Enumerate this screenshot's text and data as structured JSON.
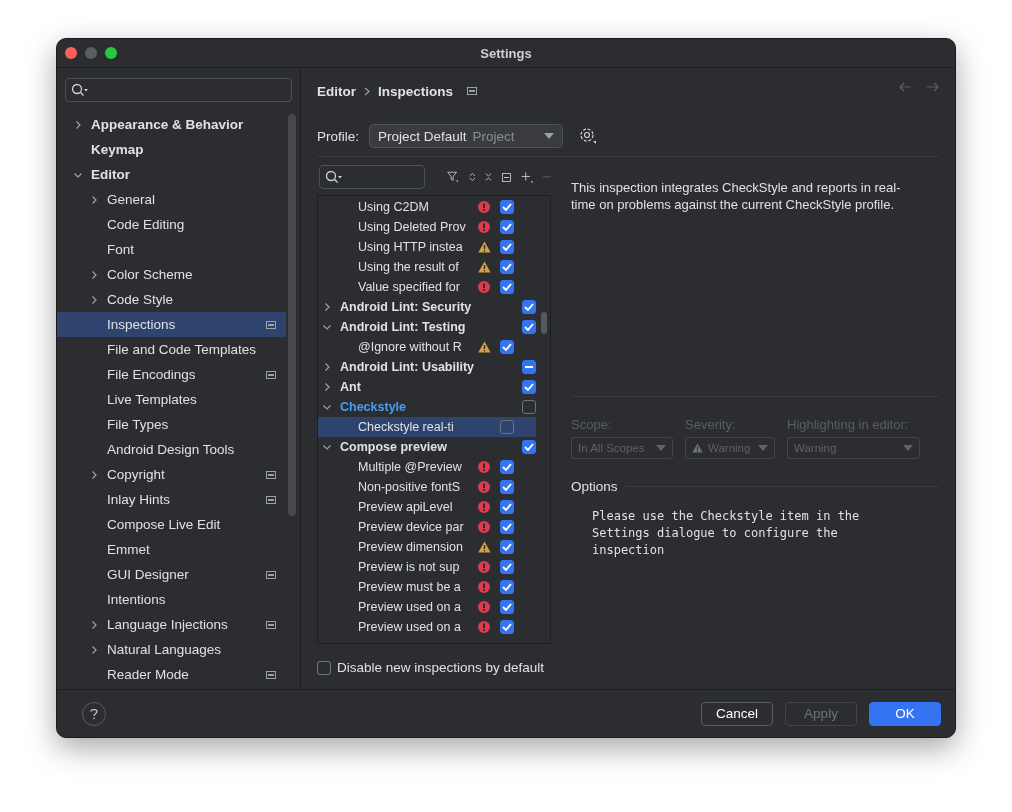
{
  "window": {
    "title": "Settings"
  },
  "sidebar": {
    "items": [
      {
        "label": "Appearance & Behavior",
        "expanded": false,
        "selected": false
      },
      {
        "label": "Keymap",
        "selected": false
      },
      {
        "label": "Editor",
        "expanded": true,
        "selected": false,
        "children": [
          {
            "label": "General",
            "expanded": false,
            "selected": false
          },
          {
            "label": "Code Editing",
            "selected": false
          },
          {
            "label": "Font",
            "selected": false
          },
          {
            "label": "Color Scheme",
            "expanded": false,
            "selected": false
          },
          {
            "label": "Code Style",
            "expanded": false,
            "selected": false
          },
          {
            "label": "Inspections",
            "selected": true,
            "project_scoped": true
          },
          {
            "label": "File and Code Templates",
            "selected": false
          },
          {
            "label": "File Encodings",
            "selected": false,
            "project_scoped": true
          },
          {
            "label": "Live Templates",
            "selected": false
          },
          {
            "label": "File Types",
            "selected": false
          },
          {
            "label": "Android Design Tools",
            "selected": false
          },
          {
            "label": "Copyright",
            "expanded": false,
            "selected": false,
            "project_scoped": true
          },
          {
            "label": "Inlay Hints",
            "selected": false,
            "project_scoped": true
          },
          {
            "label": "Compose Live Edit",
            "selected": false
          },
          {
            "label": "Emmet",
            "selected": false
          },
          {
            "label": "GUI Designer",
            "selected": false,
            "project_scoped": true
          },
          {
            "label": "Intentions",
            "selected": false
          },
          {
            "label": "Language Injections",
            "expanded": false,
            "selected": false,
            "project_scoped": true
          },
          {
            "label": "Natural Languages",
            "expanded": false,
            "selected": false
          },
          {
            "label": "Reader Mode",
            "selected": false,
            "project_scoped": true
          }
        ]
      }
    ]
  },
  "breadcrumb": {
    "items": [
      "Editor",
      "Inspections"
    ],
    "project_scoped": true
  },
  "profile": {
    "label": "Profile:",
    "value": "Project Default",
    "scope": "Project"
  },
  "inspections": [
    {
      "kind": "group",
      "children": [
        {
          "kind": "error",
          "name": "Using C2DM",
          "checked": true,
          "selected": false
        },
        {
          "kind": "error",
          "name": "Using Deleted Prov",
          "checked": true,
          "selected": false
        },
        {
          "kind": "warning",
          "name": "Using HTTP instea",
          "checked": true,
          "selected": false
        },
        {
          "kind": "warning",
          "name": "Using the result of",
          "checked": true,
          "selected": false
        },
        {
          "kind": "error",
          "name": "Value specified for",
          "checked": true,
          "selected": false
        }
      ]
    },
    {
      "kind": "group",
      "name": "Android Lint: Security",
      "expanded": false,
      "checked": true,
      "selected": false
    },
    {
      "kind": "group",
      "name": "Android Lint: Testing",
      "expanded": true,
      "checked": true,
      "selected": false,
      "children": [
        {
          "kind": "warning",
          "name": "@Ignore without R",
          "checked": true,
          "selected": false
        }
      ]
    },
    {
      "kind": "group",
      "name": "Android Lint: Usability",
      "expanded": false,
      "checked": true,
      "partial": true,
      "selected": false
    },
    {
      "kind": "group",
      "name": "Ant",
      "expanded": false,
      "checked": true,
      "selected": false
    },
    {
      "kind": "group",
      "name": "Checkstyle",
      "expanded": true,
      "checked": false,
      "modified": true,
      "selected": false,
      "children": [
        {
          "kind": "plain",
          "name": "Checkstyle real-ti",
          "checked": false,
          "selected": true
        }
      ]
    },
    {
      "kind": "group",
      "name": "Compose preview",
      "expanded": true,
      "checked": true,
      "selected": false,
      "children": [
        {
          "kind": "error",
          "name": "Multiple @Preview",
          "checked": true,
          "selected": false
        },
        {
          "kind": "error",
          "name": "Non-positive fontS",
          "checked": true,
          "selected": false
        },
        {
          "kind": "error",
          "name": "Preview apiLevel",
          "checked": true,
          "selected": false
        },
        {
          "kind": "error",
          "name": "Preview device par",
          "checked": true,
          "selected": false
        },
        {
          "kind": "warning",
          "name": "Preview dimension",
          "checked": true,
          "selected": false
        },
        {
          "kind": "error",
          "name": "Preview is not sup",
          "checked": true,
          "selected": false
        },
        {
          "kind": "error",
          "name": "Preview must be a",
          "checked": true,
          "selected": false
        },
        {
          "kind": "error",
          "name": "Preview used on a",
          "checked": true,
          "selected": false
        },
        {
          "kind": "error",
          "name": "Preview used on a",
          "checked": true,
          "selected": false
        }
      ]
    }
  ],
  "disable_new": {
    "label": "Disable new inspections by default",
    "checked": false
  },
  "description": "This inspection integrates CheckStyle and reports in real-time on problems against the current CheckStyle profile.",
  "settings": [
    {
      "kind": "plain",
      "label": "Scope:",
      "value": "In All Scopes",
      "disabled": true
    },
    {
      "kind": "warning",
      "label": "Severity:",
      "value": "Warning",
      "disabled": true
    },
    {
      "kind": "plain",
      "label": "Highlighting in editor:",
      "value": "Warning",
      "disabled": true
    }
  ],
  "options": {
    "title": "Options",
    "text": "Please use the Checkstyle item in the Settings dialogue to configure the inspection"
  },
  "buttons": [
    {
      "label": "Cancel",
      "kind": "normal",
      "disabled": false
    },
    {
      "label": "Apply",
      "kind": "normal",
      "disabled": true
    },
    {
      "label": "OK",
      "kind": "primary",
      "disabled": false
    }
  ]
}
